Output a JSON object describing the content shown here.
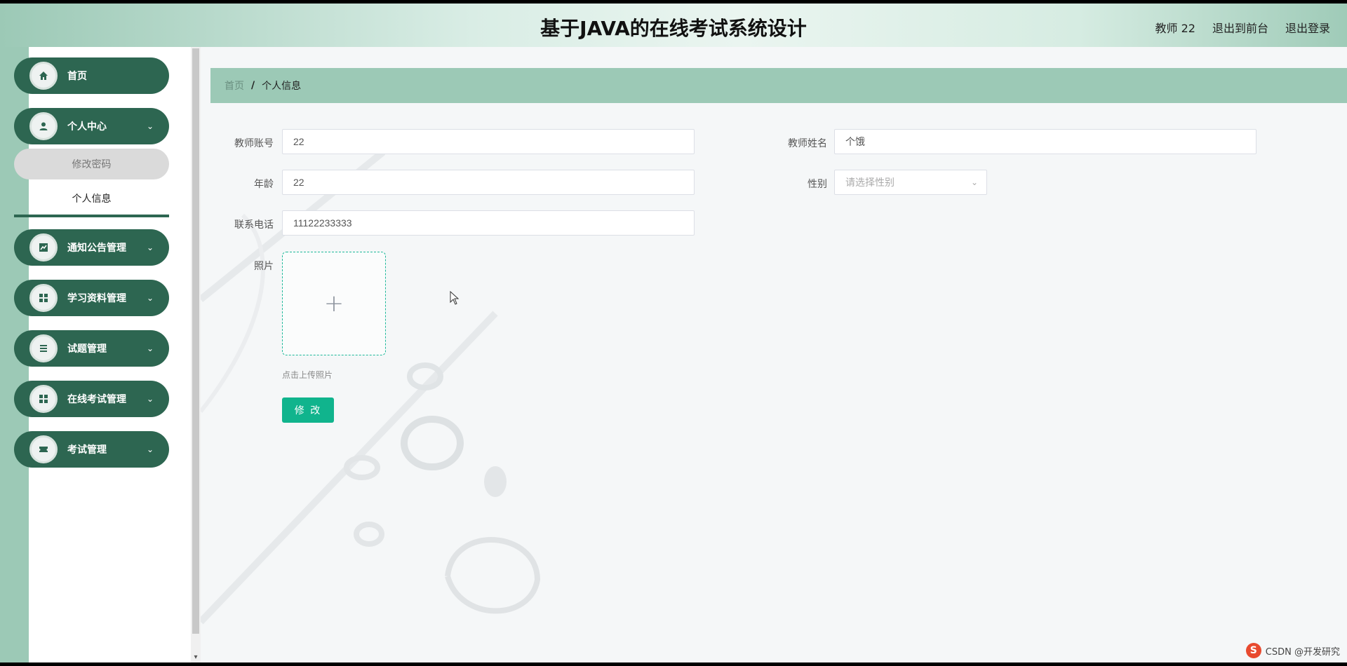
{
  "header": {
    "title": "基于JAVA的在线考试系统设计",
    "user_label": "教师 22",
    "front_link": "退出到前台",
    "logout_link": "退出登录"
  },
  "sidebar": {
    "items": [
      {
        "label": "首页",
        "icon": "home-icon"
      },
      {
        "label": "个人中心",
        "icon": "user-icon"
      },
      {
        "label": "通知公告管理",
        "icon": "chart-icon"
      },
      {
        "label": "学习资料管理",
        "icon": "grid-icon"
      },
      {
        "label": "试题管理",
        "icon": "list-icon"
      },
      {
        "label": "在线考试管理",
        "icon": "grid-icon"
      },
      {
        "label": "考试管理",
        "icon": "ticket-icon"
      }
    ],
    "sub_items": {
      "change_password": "修改密码",
      "profile": "个人信息"
    }
  },
  "breadcrumb": {
    "home": "首页",
    "separator": "/",
    "current": "个人信息"
  },
  "form": {
    "account_label": "教师账号",
    "account_value": "22",
    "name_label": "教师姓名",
    "name_value": "个饿",
    "age_label": "年龄",
    "age_value": "22",
    "gender_label": "性别",
    "gender_placeholder": "请选择性别",
    "phone_label": "联系电话",
    "phone_value": "11122233333",
    "photo_label": "照片",
    "upload_hint": "点击上传照片",
    "submit_label": "修 改"
  },
  "watermark": "CSDN @开发研究"
}
